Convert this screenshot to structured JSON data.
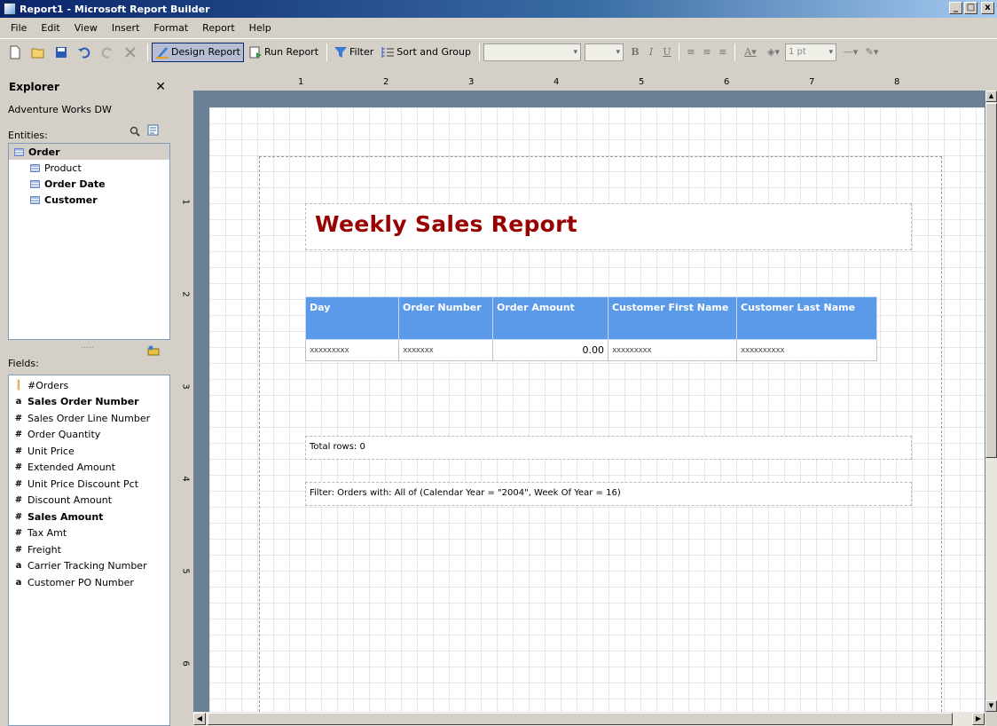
{
  "window": {
    "title": "Report1 - Microsoft Report Builder",
    "controls": [
      "_",
      "·",
      "x"
    ]
  },
  "menu": [
    "File",
    "Edit",
    "View",
    "Insert",
    "Format",
    "Report",
    "Help"
  ],
  "toolbar": {
    "design_report": "Design Report",
    "run_report": "Run Report",
    "filter": "Filter",
    "sort_group": "Sort and Group",
    "bold": "B",
    "italic": "I",
    "underline": "U",
    "line_width": "1 pt"
  },
  "explorer": {
    "title": "Explorer",
    "close": "✕",
    "data_source": "Adventure Works DW",
    "entities_label": "Entities:",
    "entities": [
      {
        "label": "Order",
        "selected": true
      },
      {
        "label": "Product"
      },
      {
        "label": "Order Date"
      },
      {
        "label": "Customer"
      }
    ],
    "splitter": ".....",
    "fields_label": "Fields:",
    "fields": [
      {
        "icon": "count",
        "glyph": "║",
        "label": "#Orders"
      },
      {
        "icon": "text",
        "glyph": "a",
        "label": "Sales Order Number",
        "bold": true
      },
      {
        "icon": "number",
        "glyph": "#",
        "label": "Sales Order Line Number"
      },
      {
        "icon": "number",
        "glyph": "#",
        "label": "Order Quantity"
      },
      {
        "icon": "number",
        "glyph": "#",
        "label": "Unit Price"
      },
      {
        "icon": "number",
        "glyph": "#",
        "label": "Extended Amount"
      },
      {
        "icon": "number",
        "glyph": "#",
        "label": "Unit Price Discount Pct"
      },
      {
        "icon": "number",
        "glyph": "#",
        "label": "Discount Amount"
      },
      {
        "icon": "number",
        "glyph": "#",
        "label": "Sales Amount",
        "bold": true
      },
      {
        "icon": "number",
        "glyph": "#",
        "label": "Tax Amt"
      },
      {
        "icon": "number",
        "glyph": "#",
        "label": "Freight"
      },
      {
        "icon": "text",
        "glyph": "a",
        "label": "Carrier Tracking Number"
      },
      {
        "icon": "text",
        "glyph": "a",
        "label": "Customer PO Number"
      }
    ]
  },
  "ruler": {
    "h_labels": [
      "1",
      "2",
      "3",
      "4",
      "5",
      "6",
      "7",
      "8"
    ],
    "v_labels": [
      "1",
      "2",
      "3",
      "4",
      "5",
      "6"
    ]
  },
  "report": {
    "title": "Weekly Sales Report",
    "title_color": "#990000",
    "header_color": "#5b9ae8",
    "columns": [
      "Day",
      "Order Number",
      "Order Amount",
      "Customer First Name",
      "Customer Last Name"
    ],
    "row": [
      "xxxxxxxxx",
      "xxxxxxx",
      "0.00",
      "xxxxxxxxx",
      "xxxxxxxxxx"
    ],
    "total_rows": "Total rows: 0",
    "filter_text": "Filter: Orders with: All of (Calendar Year = \"2004\", Week Of Year = 16)"
  }
}
